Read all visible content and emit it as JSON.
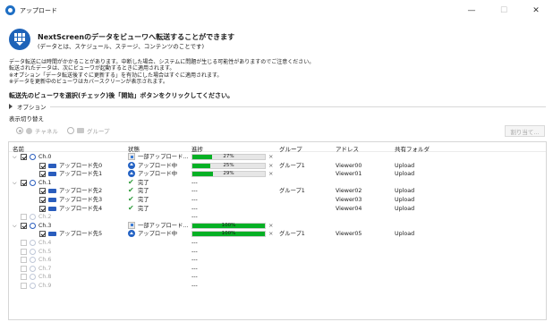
{
  "window": {
    "title": "アップロード",
    "minimize": "—",
    "maximize": "☐",
    "close": "✕"
  },
  "hero": {
    "title": "NextScreenのデータをビューワへ転送することができます",
    "subtitle": "(データとは、スケジュール、ステージ、コンテンツのことです)"
  },
  "notes": [
    "データ転送には時間がかかることがあります。中断した場合、システムに問題が生じる可能性がありますのでご注意ください。",
    "転送されたデータは、次にビューワが起動するときに適用されます。",
    "※オプション「データ転送後すぐに更新する」を有効にした場合はすぐに適用されます。",
    "※データを更新中のビューワはカバースクリーンが表示されます。"
  ],
  "instruction": "転送先のビューワを選択(チェック)後「開始」ボタンをクリックしてください。",
  "options_label": "オプション",
  "toggle_label": "表示切り替え",
  "radio": {
    "channel": "チャネル",
    "group": "グループ"
  },
  "assign_button": "割り当て...",
  "columns": {
    "name": "名前",
    "status": "状態",
    "progress": "進捗",
    "group": "グループ",
    "address": "アドレス",
    "shared_folder": "共有フォルダ"
  },
  "rows": [
    {
      "kind": "channel",
      "expanded": true,
      "checked": true,
      "enabled": true,
      "name": "Ch.0",
      "status": "一部アップロード...",
      "status_icon": "partial-upload-icon",
      "progress": 27,
      "progress_label": "27%",
      "clear": "×",
      "group": "",
      "address": "",
      "folder": ""
    },
    {
      "kind": "viewer",
      "checked": true,
      "name": "アップロード先0",
      "status": "アップロード中",
      "status_icon": "uploading-icon",
      "progress": 25,
      "progress_label": "25%",
      "clear": "×",
      "group": "グループ1",
      "address": "Viewer00",
      "folder": "Upload"
    },
    {
      "kind": "viewer",
      "checked": true,
      "name": "アップロード先1",
      "status": "アップロード中",
      "status_icon": "uploading-icon",
      "progress": 29,
      "progress_label": "29%",
      "clear": "×",
      "group": "",
      "address": "Viewer01",
      "folder": "Upload"
    },
    {
      "kind": "channel",
      "expanded": true,
      "checked": true,
      "enabled": true,
      "name": "Ch.1",
      "status": "完了",
      "status_icon": "check-icon",
      "progress_text": "---",
      "group": "",
      "address": "",
      "folder": ""
    },
    {
      "kind": "viewer",
      "checked": true,
      "name": "アップロード先2",
      "status": "完了",
      "status_icon": "check-icon",
      "progress_text": "---",
      "group": "グループ1",
      "address": "Viewer02",
      "folder": "Upload"
    },
    {
      "kind": "viewer",
      "checked": true,
      "name": "アップロード先3",
      "status": "完了",
      "status_icon": "check-icon",
      "progress_text": "---",
      "group": "",
      "address": "Viewer03",
      "folder": "Upload"
    },
    {
      "kind": "viewer",
      "checked": true,
      "name": "アップロード先4",
      "status": "完了",
      "status_icon": "check-icon",
      "progress_text": "---",
      "group": "",
      "address": "Viewer04",
      "folder": "Upload"
    },
    {
      "kind": "channel",
      "expanded": false,
      "checked": false,
      "enabled": false,
      "name": "Ch.2",
      "status": "",
      "progress_text": "---",
      "group": "",
      "address": "",
      "folder": ""
    },
    {
      "kind": "channel",
      "expanded": true,
      "checked": true,
      "enabled": true,
      "name": "Ch.3",
      "status": "一部アップロード...",
      "status_icon": "partial-upload-icon",
      "progress": 100,
      "progress_label": "100%",
      "clear": "×",
      "group": "",
      "address": "",
      "folder": ""
    },
    {
      "kind": "viewer",
      "checked": true,
      "name": "アップロード先5",
      "status": "アップロード中",
      "status_icon": "uploading-icon",
      "progress": 100,
      "progress_label": "100%",
      "clear": "×",
      "group": "グループ1",
      "address": "Viewer05",
      "folder": "Upload"
    },
    {
      "kind": "channel",
      "expanded": false,
      "checked": false,
      "enabled": false,
      "name": "Ch.4",
      "status": "",
      "progress_text": "---",
      "group": "",
      "address": "",
      "folder": ""
    },
    {
      "kind": "channel",
      "expanded": false,
      "checked": false,
      "enabled": false,
      "name": "Ch.5",
      "status": "",
      "progress_text": "---",
      "group": "",
      "address": "",
      "folder": ""
    },
    {
      "kind": "channel",
      "expanded": false,
      "checked": false,
      "enabled": false,
      "name": "Ch.6",
      "status": "",
      "progress_text": "---",
      "group": "",
      "address": "",
      "folder": ""
    },
    {
      "kind": "channel",
      "expanded": false,
      "checked": false,
      "enabled": false,
      "name": "Ch.7",
      "status": "",
      "progress_text": "---",
      "group": "",
      "address": "",
      "folder": ""
    },
    {
      "kind": "channel",
      "expanded": false,
      "checked": false,
      "enabled": false,
      "name": "Ch.8",
      "status": "",
      "progress_text": "---",
      "group": "",
      "address": "",
      "folder": ""
    },
    {
      "kind": "channel",
      "expanded": false,
      "checked": false,
      "enabled": false,
      "name": "Ch.9",
      "status": "",
      "progress_text": "---",
      "group": "",
      "address": "",
      "folder": ""
    }
  ],
  "colors": {
    "progress_fill": "#06b025",
    "accent": "#2563c4",
    "done": "#2e9b3a"
  }
}
